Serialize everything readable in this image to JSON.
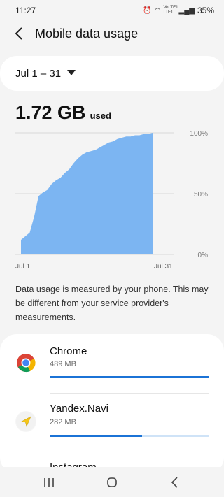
{
  "status_bar": {
    "time": "11:27",
    "signal_label": "VoLTE1 LTE1",
    "battery_percent": "35%"
  },
  "header": {
    "title": "Mobile data usage",
    "back_icon": "back-arrow-icon"
  },
  "date_range": {
    "label": "Jul 1 – 31"
  },
  "usage": {
    "total": "1.72 GB",
    "unit_label": "used"
  },
  "chart_data": {
    "type": "area",
    "x_start_label": "Jul 1",
    "x_end_label": "Jul 31",
    "y_tick_labels": [
      "100%",
      "50%",
      "0%"
    ],
    "ylim": [
      0,
      100
    ],
    "x_days": [
      1,
      2,
      3,
      4,
      5,
      6,
      7,
      8,
      9,
      10,
      11,
      12,
      13,
      14,
      15,
      16,
      17,
      18,
      19,
      20,
      21,
      22,
      23,
      24,
      25,
      26,
      27,
      28,
      29,
      30,
      31
    ],
    "values": [
      12,
      15,
      18,
      31,
      48,
      51,
      53,
      58,
      61,
      63,
      67,
      70,
      75,
      79,
      82,
      84,
      85,
      86,
      88,
      90,
      92,
      93,
      95,
      96,
      97,
      97,
      98,
      98,
      99,
      99,
      100
    ],
    "fill_color": "#7cb5f2",
    "grid": true
  },
  "note": {
    "text": "Data usage is measured by your phone. This may be different from your service provider's measurements."
  },
  "apps": [
    {
      "name": "Chrome",
      "size": "489 MB",
      "share": 1.0,
      "icon": "chrome-icon"
    },
    {
      "name": "Yandex.Navi",
      "size": "282 MB",
      "share": 0.577,
      "icon": "navigation-arrow-icon"
    },
    {
      "name": "Instagram",
      "size": "",
      "share": 0.0,
      "icon": "instagram-icon"
    }
  ],
  "colors": {
    "accent": "#1b73d6",
    "track": "#cfe3f7",
    "chart_fill": "#7cb5f2"
  }
}
